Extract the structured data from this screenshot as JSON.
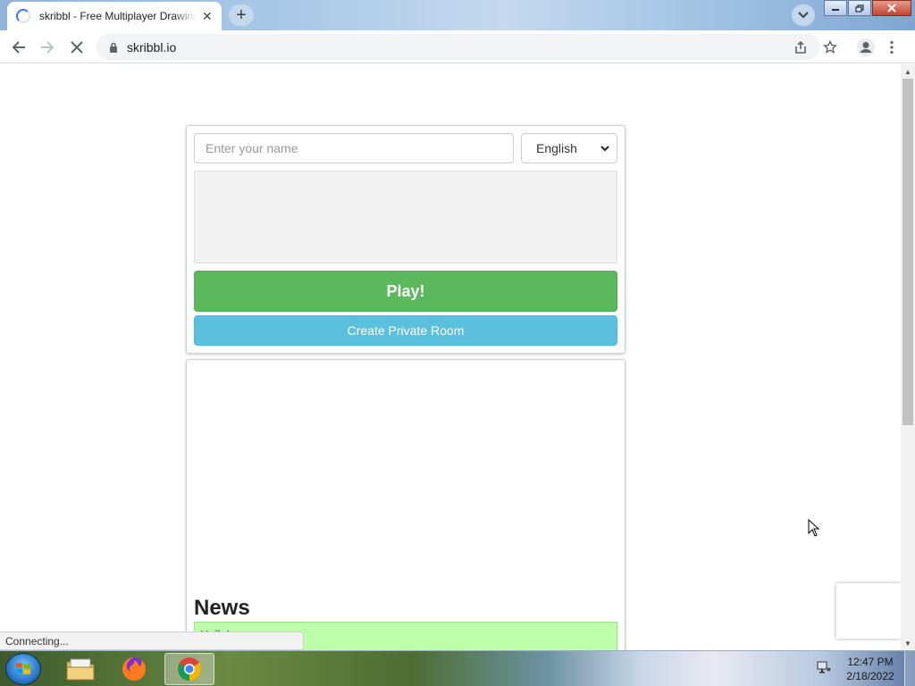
{
  "browser": {
    "tab_title": "skribbl - Free Multiplayer Drawing & Guessing Game",
    "tab_close": "✕",
    "new_tab": "+",
    "url": "skribbl.io",
    "status": "Connecting..."
  },
  "login": {
    "name_placeholder": "Enter your name",
    "language_selected": "English",
    "play_label": "Play!",
    "private_room_label": "Create Private Room"
  },
  "news": {
    "title": "News",
    "item_text": "Hello!"
  },
  "taskbar": {
    "time": "12:47 PM",
    "date": "2/18/2022"
  },
  "colors": {
    "play_green": "#5cb85c",
    "private_blue": "#5bc0de",
    "news_item_green": "#bcffa8"
  }
}
